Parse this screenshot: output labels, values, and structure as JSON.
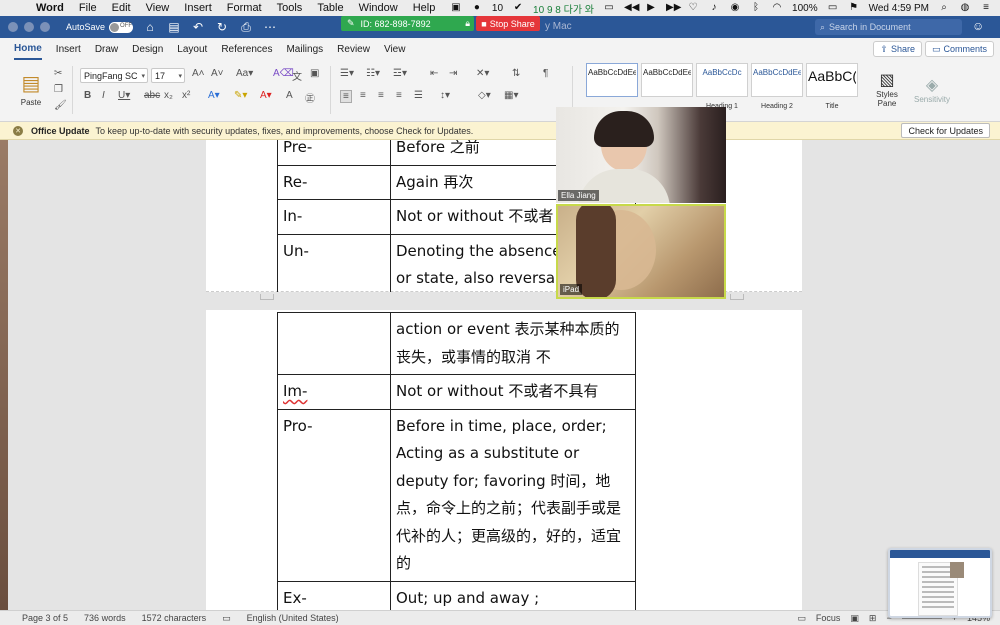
{
  "menubar": {
    "app_name": "Word",
    "items": [
      "File",
      "Edit",
      "View",
      "Insert",
      "Format",
      "Tools",
      "Table",
      "Window",
      "Help"
    ],
    "right": {
      "status_text": "10 9 8 다가 와",
      "zoom_count": "10",
      "battery": "100%",
      "clock": "Wed 4:59 PM"
    }
  },
  "titlebar": {
    "autosave_label": "AutoSave",
    "autosave_state": "OFF",
    "zoom_meeting_id": "ID: 682-898-7892",
    "stop_share_label": "Stop Share",
    "doc_title": "y Mac",
    "search_placeholder": "Search in Document"
  },
  "ribbon_tabs": [
    "Home",
    "Insert",
    "Draw",
    "Design",
    "Layout",
    "References",
    "Mailings",
    "Review",
    "View"
  ],
  "ribbon_buttons": {
    "share": "Share",
    "comments": "Comments"
  },
  "ribbon": {
    "paste_label": "Paste",
    "font_name": "PingFang SC",
    "font_size": "17",
    "styles": [
      {
        "sample": "AaBbCcDdEe",
        "name": ""
      },
      {
        "sample": "AaBbCcDdEe",
        "name": ""
      },
      {
        "sample": "AaBbCcDc",
        "name": "Heading 1"
      },
      {
        "sample": "AaBbCcDdEe",
        "name": "Heading 2"
      },
      {
        "sample": "AaBbC(",
        "name": "Title"
      }
    ],
    "styles_pane_label": "Styles Pane",
    "sensitivity_label": "Sensitivity"
  },
  "update_bar": {
    "title": "Office Update",
    "message": "To keep up-to-date with security updates, fixes, and improvements, choose Check for Updates.",
    "button": "Check for Updates"
  },
  "table_top": [
    {
      "prefix": "Pre-",
      "meaning": "Before 之前"
    },
    {
      "prefix": "Re-",
      "meaning": "Again 再次"
    },
    {
      "prefix": "In-",
      "meaning": "Not or without 不或者"
    },
    {
      "prefix": "Un-",
      "meaning": "Denoting the absence quality or state, also reversal or cancelatic"
    }
  ],
  "table_bottom": [
    {
      "prefix": "",
      "meaning": "action or event 表示某种本质的丧失，或事情的取消 不"
    },
    {
      "prefix": "Im-",
      "meaning": "Not or without 不或者不具有"
    },
    {
      "prefix": "Pro-",
      "meaning": "Before in time, place, order; Acting as a substitute or deputy for; favoring 时间，地点，命令上的之前；代表副手或是代补的人；更高级的，好的，适宜的"
    },
    {
      "prefix": "Ex-",
      "meaning": "Out; up and away ; thoroughly; over 出；上或者"
    }
  ],
  "video": {
    "tile1_name": "Ella Jiang",
    "tile2_name": "iPad"
  },
  "statusbar": {
    "page": "Page 3 of 5",
    "words": "736 words",
    "chars": "1572 characters",
    "language": "English (United States)",
    "focus": "Focus",
    "zoom": "145%"
  }
}
